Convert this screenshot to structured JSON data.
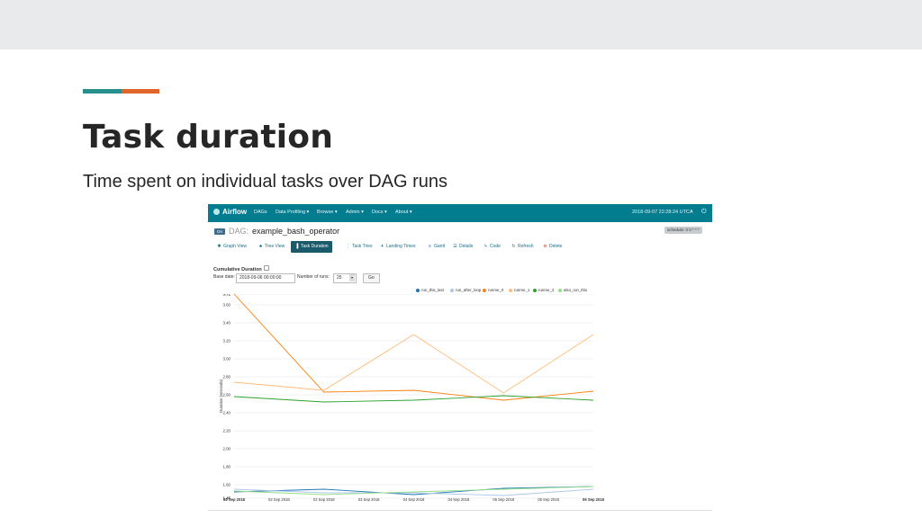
{
  "slide": {
    "title": "Task duration",
    "subtitle": "Time spent on individual tasks over DAG runs",
    "accent_colors": [
      "#27908c",
      "#e0652b"
    ]
  },
  "airflow": {
    "brand": "Airflow",
    "nav_color": "#027c8f",
    "menu": [
      "DAGs",
      "Data Profiling",
      "Browse",
      "Admin",
      "Docs",
      "About"
    ],
    "timestamp": "2018-09-07 22:28:24 UTC",
    "dag": {
      "on_badge": "On",
      "label": "DAG:",
      "dag_id": "example_bash_operator",
      "schedule": "schedule: 0 0 * * *"
    },
    "tabs": [
      {
        "label": "Graph View",
        "icon": "asterisk-icon"
      },
      {
        "label": "Tree View",
        "icon": "tree-icon"
      },
      {
        "label": "Task Duration",
        "icon": "bar-chart-icon",
        "active": true
      },
      {
        "label": "Task Tries",
        "icon": "tries-icon"
      },
      {
        "label": "Landing Times",
        "icon": "plane-icon"
      },
      {
        "label": "Gantt",
        "icon": "gantt-icon"
      },
      {
        "label": "Details",
        "icon": "list-icon"
      },
      {
        "label": "Code",
        "icon": "flash-icon"
      },
      {
        "label": "Refresh",
        "icon": "refresh-icon"
      },
      {
        "label": "Delete",
        "icon": "delete-icon"
      }
    ],
    "cumulative_label": "Cumulative Duration",
    "base_date_label": "Base date:",
    "base_date_value": "2018-09-06 00:00:00",
    "num_runs_label": "Number of runs:",
    "num_runs_value": "25",
    "go_label": "Go"
  },
  "chart_data": {
    "type": "line",
    "ylabel": "Duration (seconds)",
    "ylim": [
      1.45,
      3.72
    ],
    "yticks": [
      "1.45",
      "1.60",
      "1.80",
      "2.00",
      "2.20",
      "2.40",
      "2.60",
      "2.80",
      "3.00",
      "3.20",
      "3.40",
      "3.60",
      "3.72"
    ],
    "ytick_values": [
      1.45,
      1.6,
      1.8,
      2.0,
      2.2,
      2.4,
      2.6,
      2.8,
      3.0,
      3.2,
      3.4,
      3.6,
      3.72
    ],
    "x": [
      "02 Sep 2018",
      "03 Sep 2018",
      "04 Sep 2018",
      "05 Sep 2018",
      "06 Sep 2018"
    ],
    "xtick_labels": [
      "02 Sep 2018",
      "02 Sep 2018",
      "02 Sep 2018",
      "03 Sep 2018",
      "04 Sep 2018",
      "04 Sep 2018",
      "05 Sep 2018",
      "05 Sep 2018",
      "06 Sep 2018"
    ],
    "grid": true,
    "legend_position": "top-right",
    "series": [
      {
        "name": "run_this_last",
        "color": "#1f77b4",
        "values": [
          1.52,
          1.55,
          1.49,
          1.56,
          1.58
        ]
      },
      {
        "name": "run_after_loop",
        "color": "#aec7e8",
        "values": [
          1.55,
          1.51,
          1.51,
          1.48,
          1.55
        ]
      },
      {
        "name": "runme_0",
        "color": "#ff7f0e",
        "values": [
          3.72,
          2.63,
          2.65,
          2.54,
          2.64
        ]
      },
      {
        "name": "runme_1",
        "color": "#ffbb78",
        "values": [
          2.74,
          2.65,
          3.27,
          2.62,
          3.27
        ]
      },
      {
        "name": "runme_2",
        "color": "#2ca02c",
        "values": [
          2.58,
          2.52,
          2.54,
          2.59,
          2.54
        ]
      },
      {
        "name": "also_run_this",
        "color": "#98df8a",
        "values": [
          1.53,
          1.49,
          1.52,
          1.55,
          1.58
        ]
      }
    ]
  }
}
